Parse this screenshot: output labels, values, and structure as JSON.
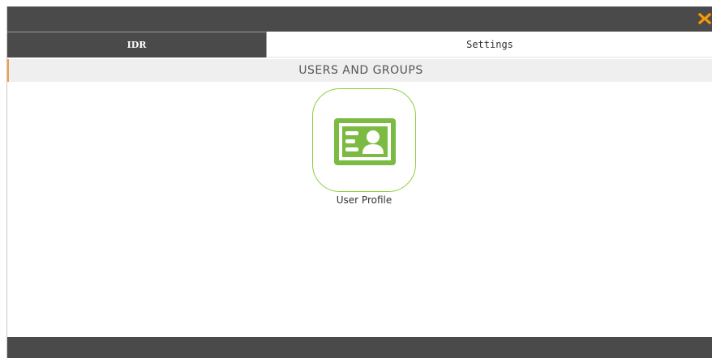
{
  "window": {
    "close_icon": "close-x-icon",
    "accent_color": "#f39c12"
  },
  "tabs": [
    {
      "label": "IDR",
      "active": true
    },
    {
      "label": "Settings",
      "active": false
    }
  ],
  "section": {
    "title": "USERS AND GROUPS"
  },
  "tiles": [
    {
      "label": "User Profile",
      "icon": "id-card-icon",
      "color": "#7cbb42"
    }
  ]
}
